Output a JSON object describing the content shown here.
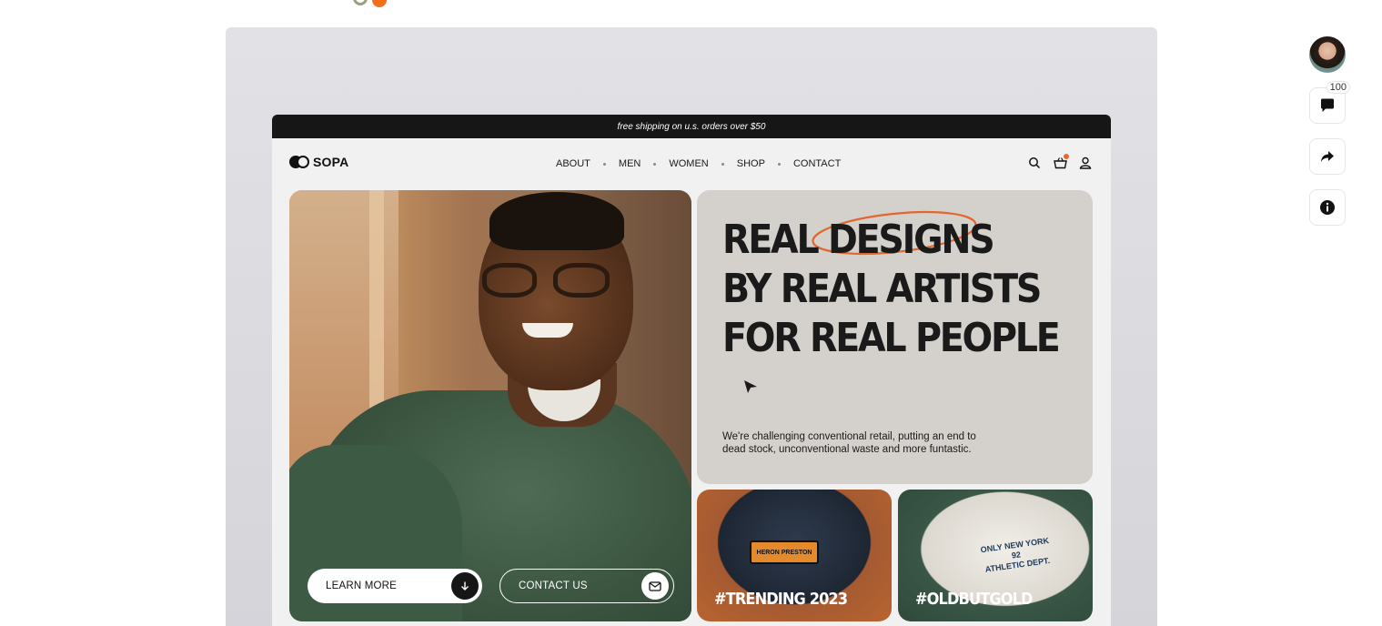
{
  "announcement": "free shipping on u.s. orders over $50",
  "brand": {
    "name": "SOPA"
  },
  "nav": {
    "items": [
      {
        "label": "ABOUT"
      },
      {
        "label": "MEN"
      },
      {
        "label": "WOMEN"
      },
      {
        "label": "SHOP"
      },
      {
        "label": "CONTACT"
      }
    ],
    "icons": [
      "search-icon",
      "cart-icon",
      "user-icon"
    ]
  },
  "hero": {
    "headline": [
      "REAL DESIGNS",
      "BY REAL ARTISTS",
      "FOR REAL PEOPLE"
    ],
    "tagline": "We're challenging conventional retail, putting an end to dead stock, unconventional waste and more funtastic.",
    "learn_more": "LEARN MORE",
    "contact_us": "CONTACT US"
  },
  "tiles": [
    {
      "label": "#TRENDING 2023"
    },
    {
      "label": "#OLDBUTGOLD"
    }
  ],
  "rail": {
    "comment_count": "100"
  },
  "colors": {
    "accent": "#e86a2c",
    "dark": "#161616",
    "card": "#d4d0cb"
  }
}
